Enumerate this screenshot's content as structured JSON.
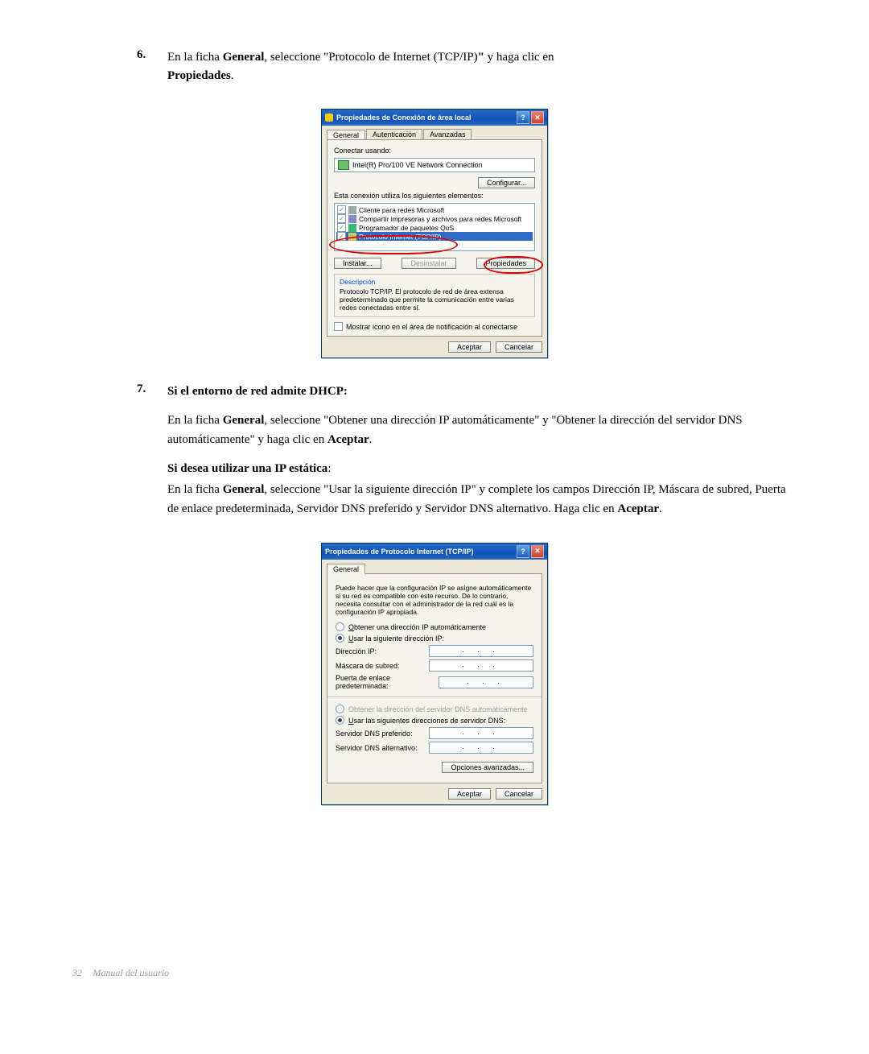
{
  "step6": {
    "num": "6.",
    "text_a": "En la ficha ",
    "bold1": "General",
    "text_b": ", seleccione \"Protocolo de Internet (TCP/IP)",
    "boldquote": "\"",
    "text_c": " y haga clic en ",
    "bold2": "Propiedades",
    "period": "."
  },
  "dlg1": {
    "title": "Propiedades de Conexión de área local",
    "tabs": {
      "general": "General",
      "auth": "Autenticación",
      "adv": "Avanzadas"
    },
    "connect_using": "Conectar usando:",
    "nic": "Intel(R) Pro/100 VE Network Connection",
    "btn_config": "Configurar...",
    "uses_elements": "Esta conexión utiliza los siguientes elementos:",
    "items": {
      "a": "Cliente para redes Microsoft",
      "b": "Compartir impresoras y archivos para redes Microsoft",
      "c": "Programador de paquetes QoS",
      "d": "Protocolo Internet (TCP/IP)"
    },
    "btn_install": "Instalar...",
    "btn_uninstall": "Desinstalar",
    "btn_props": "Propiedades",
    "desc_title": "Descripción",
    "desc": "Protocolo TCP/IP. El protocolo de red de área extensa predeterminado que permite la comunicación entre varias redes conectadas entre sí.",
    "notify": "Mostrar icono en el área de notificación al conectarse",
    "ok": "Aceptar",
    "cancel": "Cancelar"
  },
  "step7": {
    "num": "7.",
    "heading1": "Si el entorno de red admite DHCP:",
    "p1_a": "En la ficha ",
    "p1_bold": "General",
    "p1_b": ", seleccione \"Obtener una dirección IP automáticamente\" y \"Obtener la dirección del servidor DNS automáticamente\" y haga clic en ",
    "p1_bold2": "Aceptar",
    "p1_c": ".",
    "heading2_a": "Si desea utilizar una IP estática",
    "heading2_b": ":",
    "p2_a": "En la ficha ",
    "p2_bold": "General",
    "p2_b": ", seleccione \"Usar la siguiente dirección IP\" y complete los campos Dirección IP, Máscara de subred, Puerta de enlace predeterminada, Servidor DNS preferido y Servidor DNS alternativo. Haga clic en ",
    "p2_bold2": "Aceptar",
    "p2_c": "."
  },
  "dlg2": {
    "title": "Propiedades de Protocolo Internet (TCP/IP)",
    "tab": "General",
    "intro": "Puede hacer que la configuración IP se asigne automáticamente si su red es compatible con este recurso. De lo contrario, necesita consultar con el administrador de la red cuál es la configuración IP apropiada.",
    "r_auto": "Obtener una dirección IP automáticamente",
    "r_static": "Usar la siguiente dirección IP:",
    "ip": "Dirección IP:",
    "mask": "Máscara de subred:",
    "gw": "Puerta de enlace predeterminada:",
    "dns_auto": "Obtener la dirección del servidor DNS automáticamente",
    "dns_static": "Usar las siguientes direcciones de servidor DNS:",
    "dns1": "Servidor DNS preferido:",
    "dns2": "Servidor DNS alternativo:",
    "adv": "Opciones avanzadas...",
    "ok": "Aceptar",
    "cancel": "Cancelar",
    "dots": ".     .     ."
  },
  "footer": {
    "page": "32",
    "label": "Manual del usuario"
  }
}
